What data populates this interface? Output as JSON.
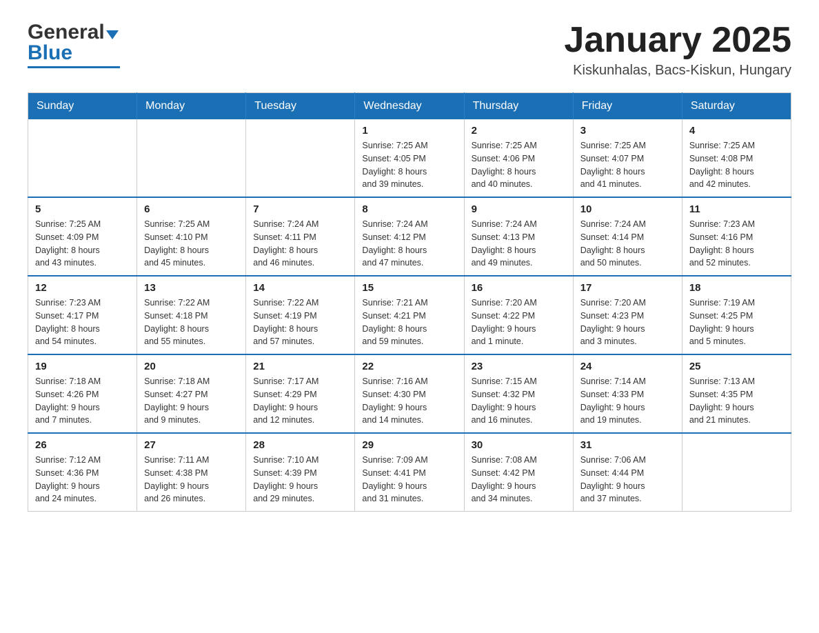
{
  "header": {
    "logo_general": "General",
    "logo_blue": "Blue",
    "main_title": "January 2025",
    "subtitle": "Kiskunhalas, Bacs-Kiskun, Hungary"
  },
  "calendar": {
    "days_of_week": [
      "Sunday",
      "Monday",
      "Tuesday",
      "Wednesday",
      "Thursday",
      "Friday",
      "Saturday"
    ],
    "weeks": [
      [
        {
          "day": "",
          "info": ""
        },
        {
          "day": "",
          "info": ""
        },
        {
          "day": "",
          "info": ""
        },
        {
          "day": "1",
          "info": "Sunrise: 7:25 AM\nSunset: 4:05 PM\nDaylight: 8 hours\nand 39 minutes."
        },
        {
          "day": "2",
          "info": "Sunrise: 7:25 AM\nSunset: 4:06 PM\nDaylight: 8 hours\nand 40 minutes."
        },
        {
          "day": "3",
          "info": "Sunrise: 7:25 AM\nSunset: 4:07 PM\nDaylight: 8 hours\nand 41 minutes."
        },
        {
          "day": "4",
          "info": "Sunrise: 7:25 AM\nSunset: 4:08 PM\nDaylight: 8 hours\nand 42 minutes."
        }
      ],
      [
        {
          "day": "5",
          "info": "Sunrise: 7:25 AM\nSunset: 4:09 PM\nDaylight: 8 hours\nand 43 minutes."
        },
        {
          "day": "6",
          "info": "Sunrise: 7:25 AM\nSunset: 4:10 PM\nDaylight: 8 hours\nand 45 minutes."
        },
        {
          "day": "7",
          "info": "Sunrise: 7:24 AM\nSunset: 4:11 PM\nDaylight: 8 hours\nand 46 minutes."
        },
        {
          "day": "8",
          "info": "Sunrise: 7:24 AM\nSunset: 4:12 PM\nDaylight: 8 hours\nand 47 minutes."
        },
        {
          "day": "9",
          "info": "Sunrise: 7:24 AM\nSunset: 4:13 PM\nDaylight: 8 hours\nand 49 minutes."
        },
        {
          "day": "10",
          "info": "Sunrise: 7:24 AM\nSunset: 4:14 PM\nDaylight: 8 hours\nand 50 minutes."
        },
        {
          "day": "11",
          "info": "Sunrise: 7:23 AM\nSunset: 4:16 PM\nDaylight: 8 hours\nand 52 minutes."
        }
      ],
      [
        {
          "day": "12",
          "info": "Sunrise: 7:23 AM\nSunset: 4:17 PM\nDaylight: 8 hours\nand 54 minutes."
        },
        {
          "day": "13",
          "info": "Sunrise: 7:22 AM\nSunset: 4:18 PM\nDaylight: 8 hours\nand 55 minutes."
        },
        {
          "day": "14",
          "info": "Sunrise: 7:22 AM\nSunset: 4:19 PM\nDaylight: 8 hours\nand 57 minutes."
        },
        {
          "day": "15",
          "info": "Sunrise: 7:21 AM\nSunset: 4:21 PM\nDaylight: 8 hours\nand 59 minutes."
        },
        {
          "day": "16",
          "info": "Sunrise: 7:20 AM\nSunset: 4:22 PM\nDaylight: 9 hours\nand 1 minute."
        },
        {
          "day": "17",
          "info": "Sunrise: 7:20 AM\nSunset: 4:23 PM\nDaylight: 9 hours\nand 3 minutes."
        },
        {
          "day": "18",
          "info": "Sunrise: 7:19 AM\nSunset: 4:25 PM\nDaylight: 9 hours\nand 5 minutes."
        }
      ],
      [
        {
          "day": "19",
          "info": "Sunrise: 7:18 AM\nSunset: 4:26 PM\nDaylight: 9 hours\nand 7 minutes."
        },
        {
          "day": "20",
          "info": "Sunrise: 7:18 AM\nSunset: 4:27 PM\nDaylight: 9 hours\nand 9 minutes."
        },
        {
          "day": "21",
          "info": "Sunrise: 7:17 AM\nSunset: 4:29 PM\nDaylight: 9 hours\nand 12 minutes."
        },
        {
          "day": "22",
          "info": "Sunrise: 7:16 AM\nSunset: 4:30 PM\nDaylight: 9 hours\nand 14 minutes."
        },
        {
          "day": "23",
          "info": "Sunrise: 7:15 AM\nSunset: 4:32 PM\nDaylight: 9 hours\nand 16 minutes."
        },
        {
          "day": "24",
          "info": "Sunrise: 7:14 AM\nSunset: 4:33 PM\nDaylight: 9 hours\nand 19 minutes."
        },
        {
          "day": "25",
          "info": "Sunrise: 7:13 AM\nSunset: 4:35 PM\nDaylight: 9 hours\nand 21 minutes."
        }
      ],
      [
        {
          "day": "26",
          "info": "Sunrise: 7:12 AM\nSunset: 4:36 PM\nDaylight: 9 hours\nand 24 minutes."
        },
        {
          "day": "27",
          "info": "Sunrise: 7:11 AM\nSunset: 4:38 PM\nDaylight: 9 hours\nand 26 minutes."
        },
        {
          "day": "28",
          "info": "Sunrise: 7:10 AM\nSunset: 4:39 PM\nDaylight: 9 hours\nand 29 minutes."
        },
        {
          "day": "29",
          "info": "Sunrise: 7:09 AM\nSunset: 4:41 PM\nDaylight: 9 hours\nand 31 minutes."
        },
        {
          "day": "30",
          "info": "Sunrise: 7:08 AM\nSunset: 4:42 PM\nDaylight: 9 hours\nand 34 minutes."
        },
        {
          "day": "31",
          "info": "Sunrise: 7:06 AM\nSunset: 4:44 PM\nDaylight: 9 hours\nand 37 minutes."
        },
        {
          "day": "",
          "info": ""
        }
      ]
    ]
  }
}
